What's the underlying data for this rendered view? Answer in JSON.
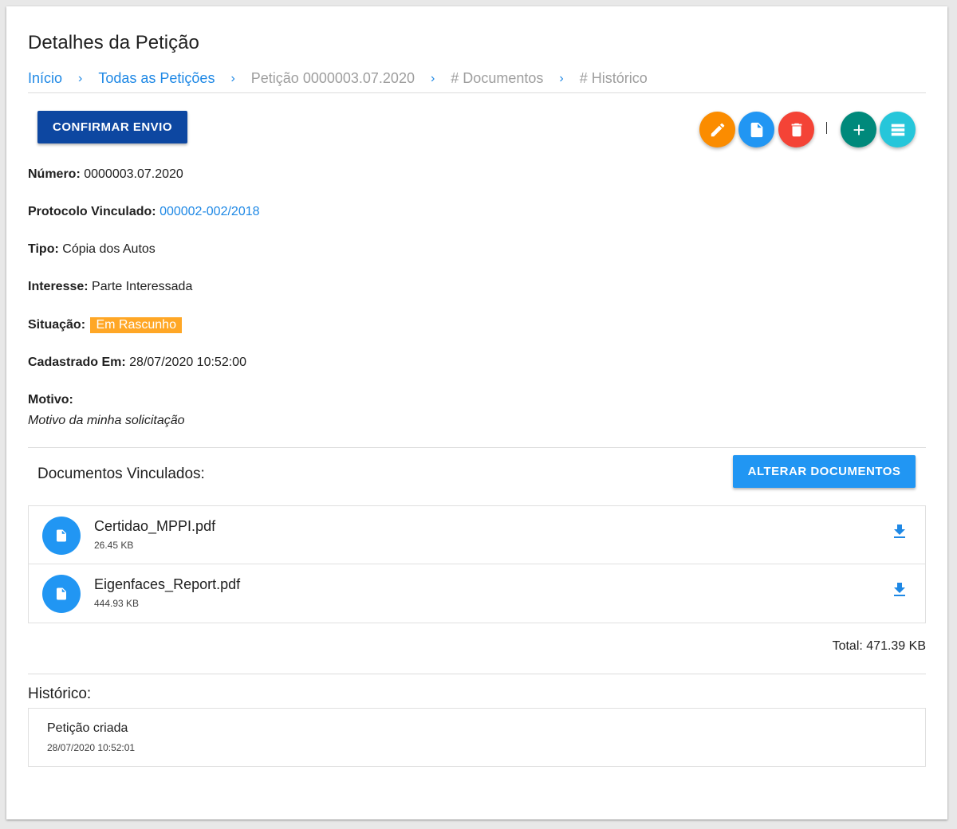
{
  "page": {
    "title": "Detalhes da Petição"
  },
  "breadcrumb": [
    {
      "label": "Início",
      "state": "link"
    },
    {
      "label": "Todas as Petições",
      "state": "link"
    },
    {
      "label": "Petição 0000003.07.2020",
      "state": "disabled"
    },
    {
      "label": "# Documentos",
      "state": "disabled"
    },
    {
      "label": "# Histórico",
      "state": "disabled"
    }
  ],
  "breadcrumb_separator": "›",
  "actions": {
    "confirm_label": "CONFIRMAR ENVIO",
    "fabs": [
      {
        "icon": "pencil-icon",
        "color": "#fb8c00"
      },
      {
        "icon": "document-icon",
        "color": "#2196f3"
      },
      {
        "icon": "trash-icon",
        "color": "#f44336"
      },
      {
        "icon": "plus-icon",
        "color": "#00897b"
      },
      {
        "icon": "list-icon",
        "color": "#26c6da"
      }
    ]
  },
  "details": {
    "numero": {
      "label": "Número:",
      "value": "0000003.07.2020"
    },
    "protocolo": {
      "label": "Protocolo Vinculado:",
      "value": "000002-002/2018"
    },
    "tipo": {
      "label": "Tipo:",
      "value": "Cópia dos Autos"
    },
    "interesse": {
      "label": "Interesse:",
      "value": "Parte Interessada"
    },
    "situacao": {
      "label": "Situação:",
      "value": "Em Rascunho",
      "color": "#ffa726"
    },
    "cadastrado": {
      "label": "Cadastrado Em:",
      "value": "28/07/2020 10:52:00"
    },
    "motivo": {
      "label": "Motivo:",
      "value": "Motivo da minha solicitação"
    }
  },
  "documents": {
    "title": "Documentos Vinculados:",
    "alter_label": "ALTERAR DOCUMENTOS",
    "items": [
      {
        "name": "Certidao_MPPI.pdf",
        "size": "26.45 KB"
      },
      {
        "name": "Eigenfaces_Report.pdf",
        "size": "444.93 KB"
      }
    ],
    "total": "Total: 471.39 KB"
  },
  "history": {
    "title": "Histórico:",
    "items": [
      {
        "text": "Petição criada",
        "date": "28/07/2020 10:52:01"
      }
    ]
  },
  "colors": {
    "primary_dark": "#0d47a1",
    "primary": "#2196f3",
    "link": "#1e88e5",
    "warning": "#ffa726"
  }
}
